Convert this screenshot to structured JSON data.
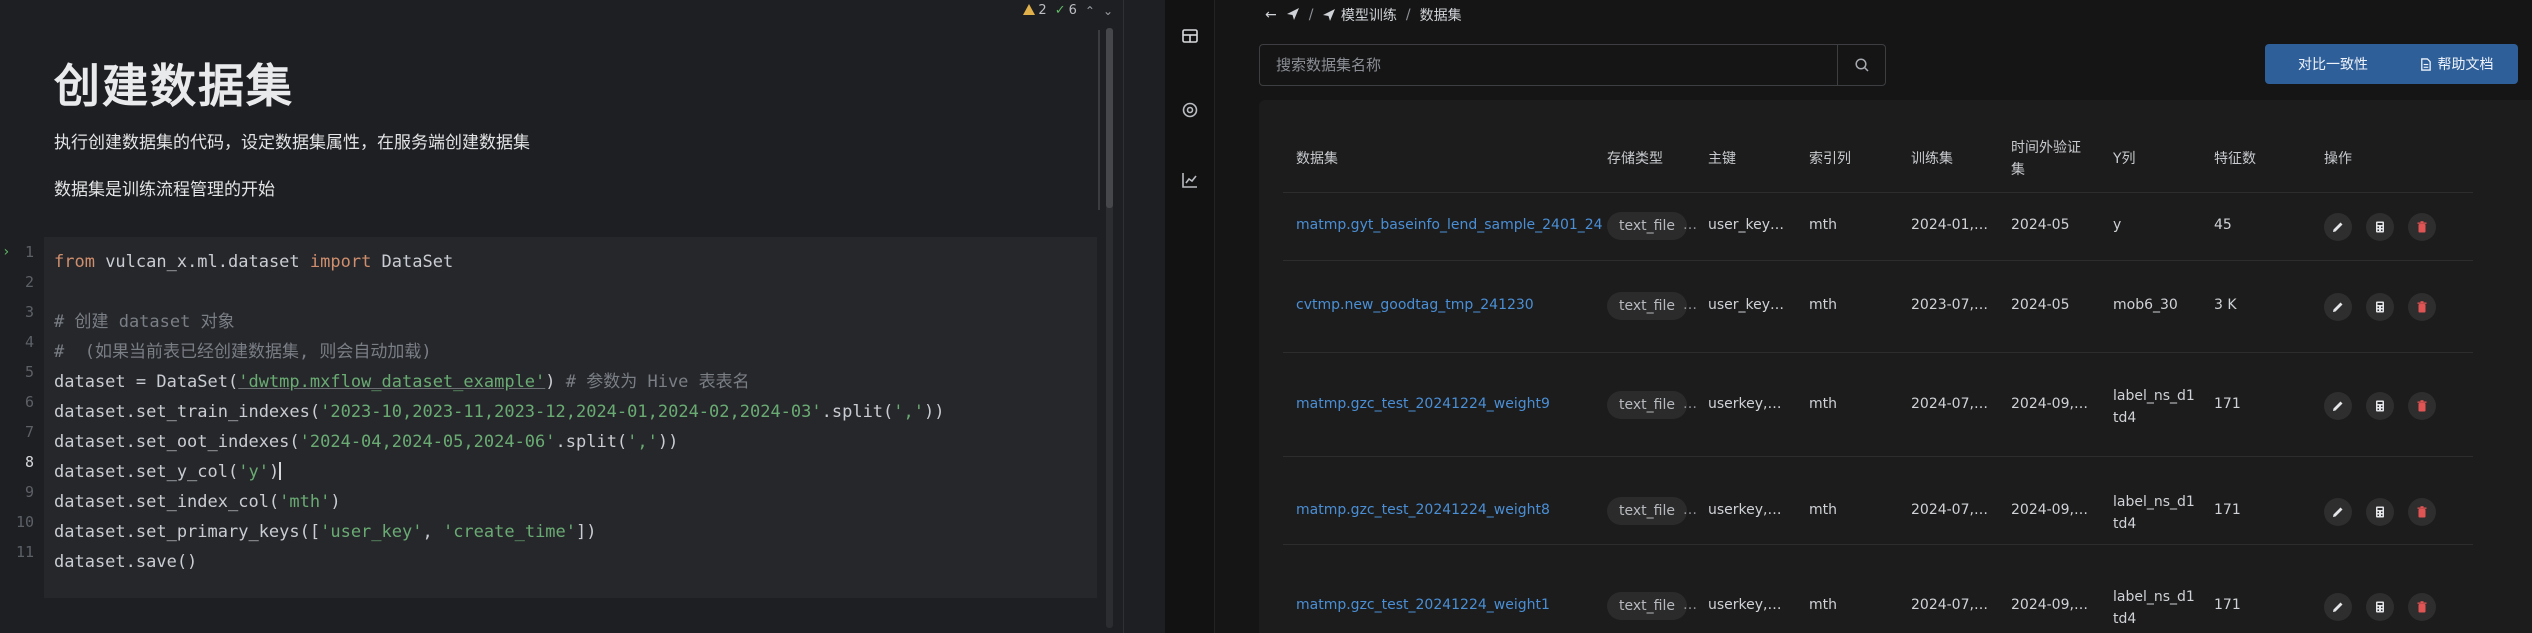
{
  "notebook": {
    "inspections": {
      "warnings": "2",
      "ok": "6"
    },
    "markdown": {
      "title": "创建数据集",
      "line1": "执行创建数据集的代码，设定数据集属性，在服务端创建数据集",
      "line2": "数据集是训练流程管理的开始"
    },
    "line_numbers": [
      "1",
      "2",
      "3",
      "4",
      "5",
      "6",
      "7",
      "8",
      "9",
      "10",
      "11"
    ],
    "active_line": "8",
    "code": {
      "l1_from": "from",
      "l1_mod": " vulcan_x.ml.dataset ",
      "l1_import": "import",
      "l1_name": " DataSet",
      "l3": "# 创建 dataset 对象",
      "l4": "#  (如果当前表已经创建数据集, 则会自动加载)",
      "l5_a": "dataset = DataSet(",
      "l5_str": "'dwtmp.mxflow_dataset_example'",
      "l5_b": ") ",
      "l5_cmt": "# 参数为 Hive 表表名",
      "l6_a": "dataset.set_train_indexes(",
      "l6_str": "'2023-10,2023-11,2023-12,2024-01,2024-02,2024-03'",
      "l6_b": ".split(",
      "l6_str2": "','",
      "l6_c": "))",
      "l7_a": "dataset.set_oot_indexes(",
      "l7_str": "'2024-04,2024-05,2024-06'",
      "l7_b": ".split(",
      "l7_str2": "','",
      "l7_c": "))",
      "l8_a": "dataset.set_y_col(",
      "l8_str": "'y'",
      "l8_b": ")",
      "l9_a": "dataset.set_index_col(",
      "l9_str": "'mth'",
      "l9_b": ")",
      "l10_a": "dataset.set_primary_keys([",
      "l10_str": "'user_key'",
      "l10_b": ", ",
      "l10_str2": "'create_time'",
      "l10_c": "])",
      "l11": "dataset.save()"
    }
  },
  "app": {
    "breadcrumb": {
      "back": "←",
      "item1": "模型训练",
      "item2": "数据集",
      "sep": "/"
    },
    "search": {
      "placeholder": "搜索数据集名称"
    },
    "buttons": {
      "compare": "对比一致性",
      "help": "帮助文档"
    },
    "table": {
      "headers": {
        "dataset": "数据集",
        "storage": "存储类型",
        "key": "主键",
        "index": "索引列",
        "train": "训练集",
        "oot_1": "时间外验证",
        "oot_2": "集",
        "y": "Y列",
        "features": "特征数",
        "actions": "操作"
      },
      "rows": [
        {
          "name": "matmp.gyt_baseinfo_lend_sample_2401_24",
          "storage": "text_file",
          "storage_more": "…",
          "key": "user_key…",
          "index": "mth",
          "train": "2024-01,…",
          "oot": "2024-05",
          "y1": "y",
          "y2": "",
          "features": "45"
        },
        {
          "name": "cvtmp.new_goodtag_tmp_241230",
          "storage": "text_file",
          "storage_more": "…",
          "key": "user_key…",
          "index": "mth",
          "train": "2023-07,…",
          "oot": "2024-05",
          "y1": "mob6_30",
          "y2": "",
          "features": "3 K"
        },
        {
          "name": "matmp.gzc_test_20241224_weight9",
          "storage": "text_file",
          "storage_more": "…",
          "key": "userkey,…",
          "index": "mth",
          "train": "2024-07,…",
          "oot": "2024-09,…",
          "y1": "label_ns_d1",
          "y2": "td4",
          "features": "171"
        },
        {
          "name": "matmp.gzc_test_20241224_weight8",
          "storage": "text_file",
          "storage_more": "…",
          "key": "userkey,…",
          "index": "mth",
          "train": "2024-07,…",
          "oot": "2024-09,…",
          "y1": "label_ns_d1",
          "y2": "td4",
          "features": "171"
        },
        {
          "name": "matmp.gzc_test_20241224_weight1",
          "storage": "text_file",
          "storage_more": "…",
          "key": "userkey,…",
          "index": "mth",
          "train": "2024-07,…",
          "oot": "2024-09,…",
          "y1": "label_ns_d1",
          "y2": "td4",
          "features": "171"
        }
      ]
    },
    "colors": {
      "accent": "#2f5f99",
      "link": "#4a8fd6",
      "delete": "#e05454"
    }
  }
}
